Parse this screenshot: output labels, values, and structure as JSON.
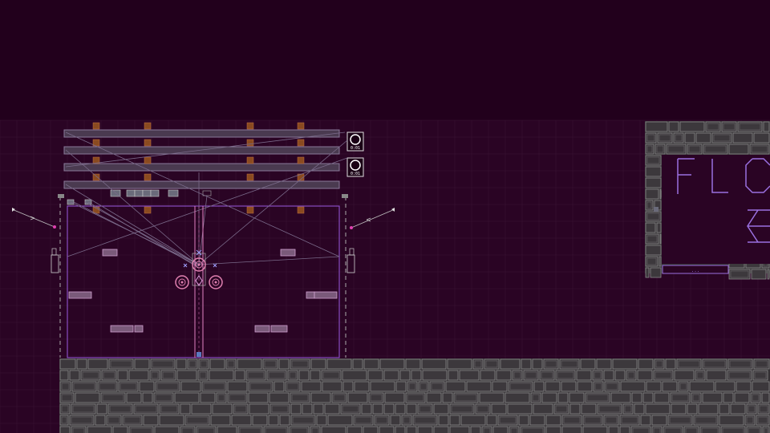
{
  "editor": {
    "background": "#22001c",
    "grid_color": "#3a1535",
    "outline_color": "#8a4fd0",
    "accent_color": "#d080c0",
    "cable_color": "#7a6a8a",
    "timber_color": "#4a3a50",
    "stone_color": "#5a5a5a",
    "peg_color": "#8a4a20"
  },
  "switches": [
    {
      "label": "0:01"
    },
    {
      "label": "0:01"
    }
  ],
  "sign": {
    "title_glyphs": "FL",
    "plaque_label": "..."
  },
  "icons": {
    "flag": "flag-icon",
    "wheel": "pulley-wheel-icon",
    "gear": "gear-icon",
    "lamp": "lamp-icon",
    "arrow": "arrow-icon"
  }
}
